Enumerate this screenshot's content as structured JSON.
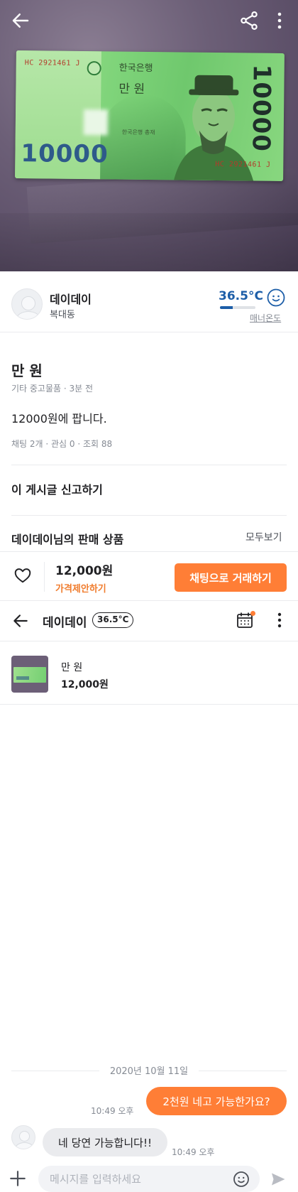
{
  "banknote": {
    "serial": "HC 2921461 J",
    "bank_name": "한국은행",
    "denomination_word": "만 원",
    "denomination_number": "10000",
    "stamp_text": "한국은행 총재"
  },
  "seller": {
    "name": "데이데이",
    "location": "복대동",
    "temperature": "36.5°C",
    "temperature_fill_percent": 36.5,
    "temperature_label": "매너온도",
    "temperature_color": "#1d5ea8"
  },
  "listing": {
    "title": "만 원",
    "meta": "기타 중고물품 · 3분 전",
    "description": "12000원에 팝니다.",
    "stats": "채팅 2개 · 관심 0 · 조회 88",
    "report": "이 게시글 신고하기",
    "more_from_seller": "데이데이님의 판매 상품",
    "see_all": "모두보기"
  },
  "action_bar": {
    "price": "12,000원",
    "offer_label": "가격제안하기",
    "chat_button": "채팅으로 거래하기",
    "accent_color": "#ff7e36"
  },
  "chat": {
    "partner_name": "데이데이",
    "partner_temperature": "36.5°C",
    "product_title": "만 원",
    "product_price": "12,000원",
    "date": "2020년 10월 11일",
    "messages": [
      {
        "direction": "out",
        "text": "2천원 네고 가능한가요?",
        "time": "10:49 오후"
      },
      {
        "direction": "in",
        "text": "네 당연 가능합니다!!",
        "time": "10:49 오후"
      }
    ],
    "input_placeholder": "메시지를 입력하세요"
  },
  "icons": {
    "back": "arrow-left-icon",
    "share": "share-icon",
    "more": "kebab-icon",
    "like": "heart-icon",
    "calendar": "calendar-icon",
    "add": "plus-icon",
    "emoji": "emoji-icon",
    "send": "send-icon",
    "manner": "smile-face-icon"
  }
}
